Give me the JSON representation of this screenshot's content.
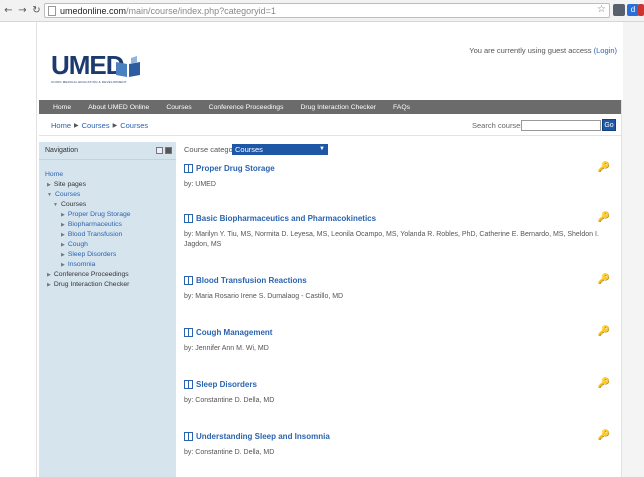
{
  "browser": {
    "url_host": "umedonline.com",
    "url_path": "/main/course/index.php?categoryid=1",
    "back_icon": "arrow-left-icon",
    "forward_icon": "arrow-right-icon",
    "reload_icon": "reload-icon",
    "ext_d": "d"
  },
  "header": {
    "logo_text": "UMED",
    "logo_sub": "UNION MEDICAL EDUCATION & DEVELOPMENT",
    "login_prefix": "You are currently using guest access",
    "login_link": "(Login)"
  },
  "menu": [
    "Home",
    "About UMED Online",
    "Courses",
    "Conference Proceedings",
    "Drug Interaction Checker",
    "FAQs"
  ],
  "breadcrumb": [
    "Home",
    "Courses",
    "Courses"
  ],
  "search": {
    "label": "Search courses:",
    "go_label": "Go"
  },
  "nav": {
    "title": "Navigation",
    "home": "Home",
    "site_pages": "Site pages",
    "courses": "Courses",
    "courses_sub": "Courses",
    "items": [
      "Proper Drug Storage",
      "Biopharmaceutics",
      "Blood Transfusion",
      "Cough",
      "Sleep Disorders",
      "Insomnia"
    ],
    "conference": "Conference Proceedings",
    "drug_checker": "Drug Interaction Checker"
  },
  "main": {
    "category_label": "Course categories:",
    "category_value": "Courses",
    "courses": [
      {
        "title": "Proper Drug Storage",
        "by": "by: UMED"
      },
      {
        "title": "Basic Biopharmaceutics and Pharmacokinetics",
        "by": "by: Marilyn Y. Tiu, MS, Normita D. Leyesa, MS, Leonila Ocampo, MS, Yolanda R. Robles, PhD, Catherine E. Bernardo, MS, Sheldon I. Jagdon, MS"
      },
      {
        "title": "Blood Transfusion Reactions",
        "by": "by: Maria Rosario Irene S. Dumalaog - Castillo, MD"
      },
      {
        "title": "Cough Management",
        "by": "by: Jennifer Ann M. Wi, MD"
      },
      {
        "title": "Sleep Disorders",
        "by": "by: Constantine D. Della, MD"
      },
      {
        "title": "Understanding Sleep and Insomnia",
        "by": "by: Constantine D. Della, MD"
      }
    ]
  }
}
